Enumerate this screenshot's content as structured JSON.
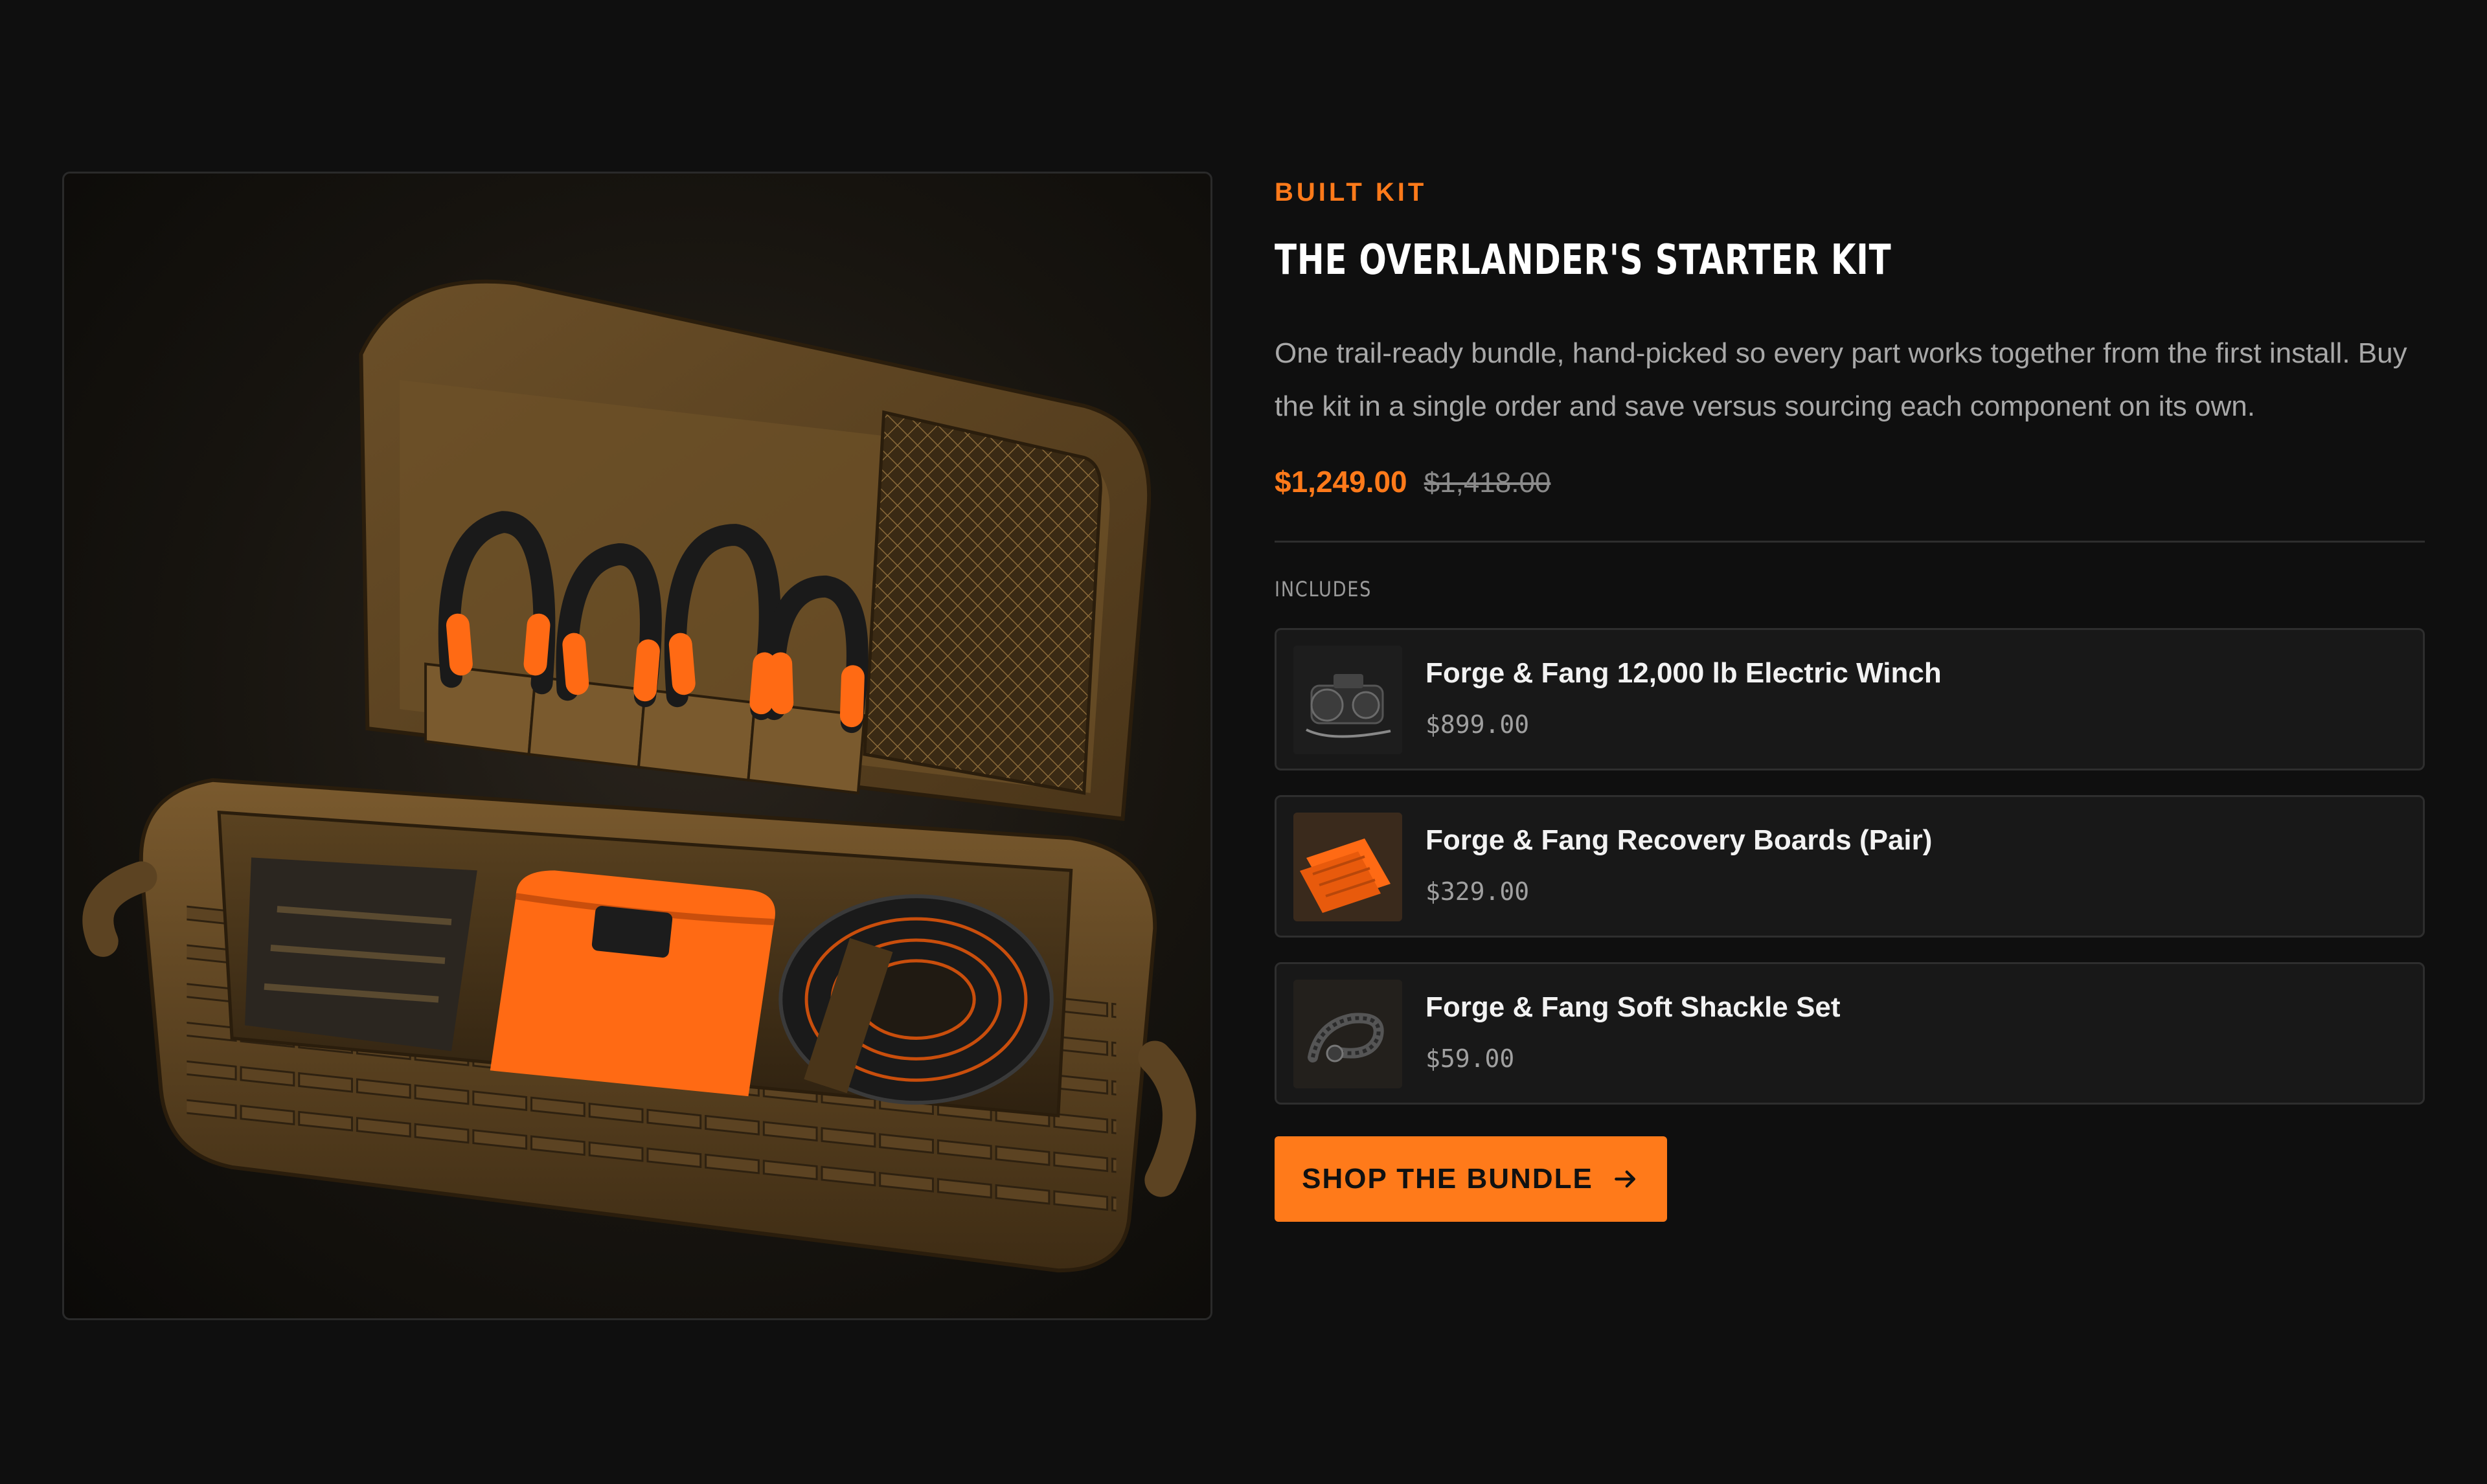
{
  "kit": {
    "eyebrow": "BUILT KIT",
    "title": "THE OVERLANDER'S STARTER KIT",
    "description": "One trail-ready bundle, hand-picked so every part works together from the first install. Buy the kit in a single order and save versus sourcing each component on its own.",
    "price": "$1,249.00",
    "compare_price": "$1,418.00",
    "includes_label": "INCLUDES",
    "items": [
      {
        "name": "Forge & Fang 12,000 lb Electric Winch",
        "price": "$899.00",
        "icon": "winch-thumbnail"
      },
      {
        "name": "Forge & Fang Recovery Boards (Pair)",
        "price": "$329.00",
        "icon": "recovery-boards-thumbnail"
      },
      {
        "name": "Forge & Fang Soft Shackle Set",
        "price": "$59.00",
        "icon": "soft-shackle-thumbnail"
      }
    ],
    "cta_label": "SHOP THE BUNDLE",
    "cta_icon": "arrow-right-icon"
  },
  "colors": {
    "background": "#0f0f0f",
    "accent": "#ff7a1a",
    "card": "#181818",
    "border": "#2e2e2e"
  }
}
